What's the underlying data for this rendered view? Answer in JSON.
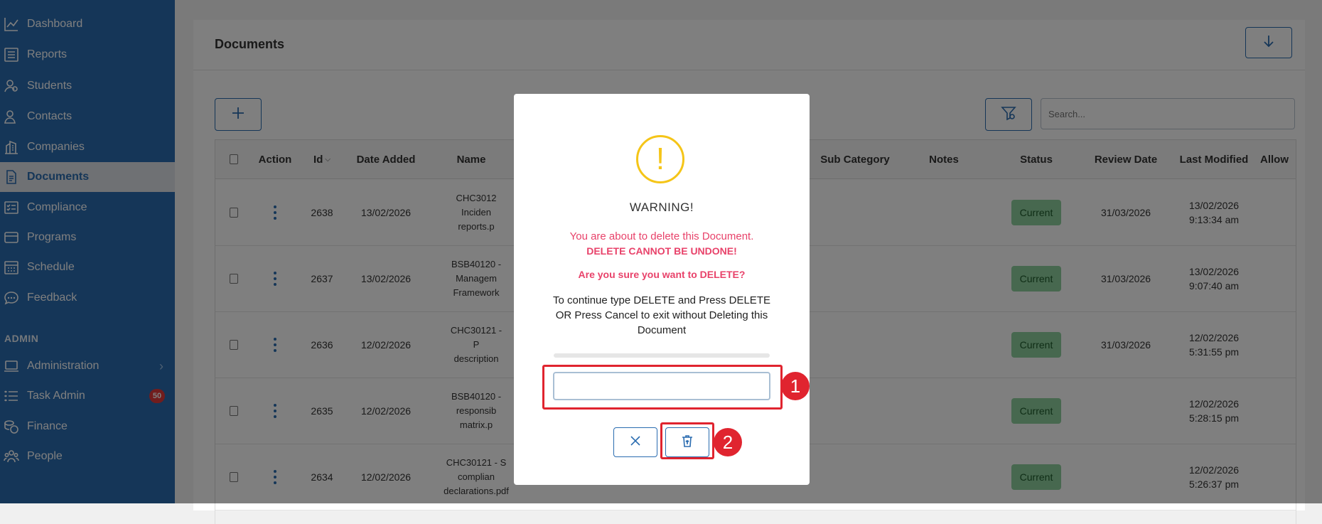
{
  "sidebar": {
    "items": [
      {
        "label": "Dashboard",
        "icon": "chart-line-icon"
      },
      {
        "label": "Reports",
        "icon": "report-icon"
      },
      {
        "label": "Students",
        "icon": "students-icon"
      },
      {
        "label": "Contacts",
        "icon": "contacts-icon"
      },
      {
        "label": "Companies",
        "icon": "building-icon"
      },
      {
        "label": "Documents",
        "icon": "document-icon",
        "active": true
      },
      {
        "label": "Compliance",
        "icon": "checklist-icon"
      },
      {
        "label": "Programs",
        "icon": "programs-icon"
      },
      {
        "label": "Schedule",
        "icon": "calendar-icon"
      },
      {
        "label": "Feedback",
        "icon": "chat-icon"
      }
    ],
    "admin_heading": "ADMIN",
    "admin_items": [
      {
        "label": "Administration",
        "icon": "laptop-icon",
        "chevron": "›"
      },
      {
        "label": "Task Admin",
        "icon": "list-icon",
        "badge": "50"
      },
      {
        "label": "Finance",
        "icon": "coins-icon"
      },
      {
        "label": "People",
        "icon": "people-icon"
      }
    ]
  },
  "page": {
    "title": "Documents",
    "search_placeholder": "Search..."
  },
  "table": {
    "headers": [
      "Action",
      "Id",
      "Date Added",
      "Name",
      "Sub Category",
      "Notes",
      "Status",
      "Review Date",
      "Last Modified",
      "Allow"
    ],
    "rows": [
      {
        "id": "2638",
        "date_added": "13/02/2026",
        "name": "CHC3012 Inciden reports.p",
        "status": "Current",
        "review_date": "31/03/2026",
        "modified_date": "13/02/2026",
        "modified_time": "9:13:34 am"
      },
      {
        "id": "2637",
        "date_added": "13/02/2026",
        "name": "BSB40120 - Managem Framework",
        "status": "Current",
        "review_date": "31/03/2026",
        "modified_date": "13/02/2026",
        "modified_time": "9:07:40 am"
      },
      {
        "id": "2636",
        "date_added": "12/02/2026",
        "name": "CHC30121 - P description",
        "status": "Current",
        "review_date": "31/03/2026",
        "modified_date": "12/02/2026",
        "modified_time": "5:31:55 pm"
      },
      {
        "id": "2635",
        "date_added": "12/02/2026",
        "name": "BSB40120 - responsib matrix.p",
        "status": "Current",
        "review_date": "",
        "modified_date": "12/02/2026",
        "modified_time": "5:28:15 pm"
      },
      {
        "id": "2634",
        "date_added": "12/02/2026",
        "name": "CHC30121 - S complian declarations.pdf",
        "status": "Current",
        "review_date": "",
        "modified_date": "12/02/2026",
        "modified_time": "5:26:37 pm"
      }
    ]
  },
  "modal": {
    "icon": "warning-icon",
    "icon_glyph": "!",
    "title": "WARNING!",
    "line1": "You are about to delete this Document.",
    "line2": "DELETE CANNOT BE UNDONE!",
    "line3": "Are you sure you want to DELETE?",
    "instructions": "To continue type DELETE and Press DELETE OR Press Cancel to exit without Deleting this Document",
    "input_value": "",
    "input_placeholder": ""
  },
  "annotations": {
    "marker1": "1",
    "marker2": "2"
  },
  "colors": {
    "sidebar": "#2a6cb0",
    "accent": "#2a6cb0",
    "status_current": "#8fd19e",
    "warning": "#f5c518",
    "danger_text": "#e8426a",
    "highlight": "#e0242f",
    "badge": "#e23b3b"
  }
}
